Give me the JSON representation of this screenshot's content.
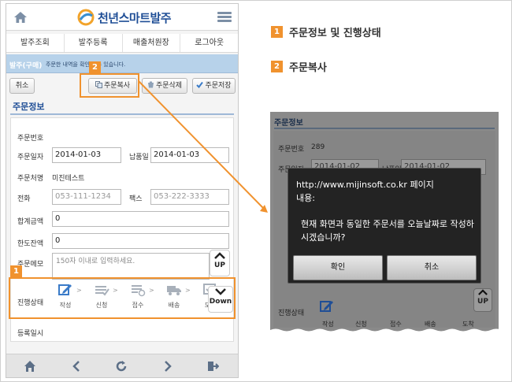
{
  "app": {
    "title": "천년스마트발주"
  },
  "nav": [
    "발주조회",
    "발주등록",
    "매출처원장",
    "로그아웃"
  ],
  "banner": {
    "title": "발주(구매)",
    "desc": "주문한 내역을 확인할 수 있습니다."
  },
  "toolbar": {
    "cancel": "취소",
    "copy": "주문복사",
    "delete": "주문삭제",
    "save": "주문저장"
  },
  "section": {
    "title": "주문정보"
  },
  "form": {
    "order_no_label": "주문번호",
    "order_date_label": "주문일자",
    "order_date": "2014-01-03",
    "due_date_label": "납품일",
    "due_date": "2014-01-03",
    "orderer_label": "주문처명",
    "orderer": "미진테스트",
    "phone_label": "전화",
    "phone_placeholder": "053-111-1234",
    "fax_label": "팩스",
    "fax_placeholder": "053-222-3333",
    "total_label": "합계금액",
    "total": "0",
    "limit_label": "한도잔액",
    "limit": "0",
    "memo_label": "주문메모",
    "memo_placeholder": "150자 이내로 입력하세요.",
    "status_label": "진행상태",
    "steps": [
      "작성",
      "신청",
      "접수",
      "배송",
      "도착"
    ],
    "reg_label": "등록일시"
  },
  "scroll": {
    "up": "UP",
    "down": "Down"
  },
  "callouts": {
    "one": "1",
    "two": "2"
  },
  "legend": [
    {
      "num": "1",
      "text": "주문정보 및 진행상태"
    },
    {
      "num": "2",
      "text": "주문복사"
    }
  ],
  "zoom": {
    "section_title": "주문정보",
    "order_no_label": "주문번호",
    "order_no": "289",
    "order_date_label": "주문일자",
    "order_date": "2014-01-02",
    "due_date_label": "납품일",
    "due_date": "2014-01-02",
    "status_label": "진행상태",
    "steps": [
      "작성",
      "신청",
      "접수",
      "배송",
      "도착"
    ],
    "up": "UP",
    "dialog": {
      "line1": "http://www.mijinsoft.co.kr 페이지",
      "line2": "내용:",
      "message": "현재 화면과 동일한 주문서를 오늘날짜로 작성하시겠습니까?",
      "confirm": "확인",
      "cancel": "취소"
    }
  },
  "colors": {
    "accent": "#f0922e",
    "brand": "#1f4e96",
    "banner": "#b7d2ea"
  }
}
